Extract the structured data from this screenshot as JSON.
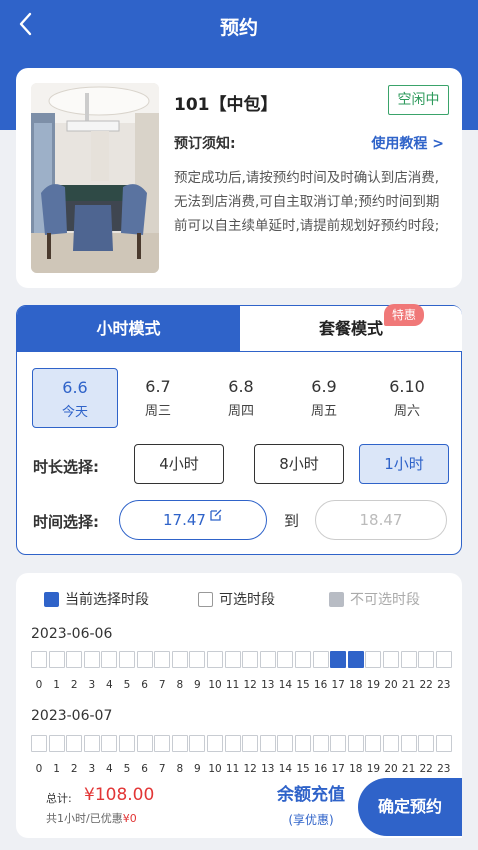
{
  "header": {
    "title": "预约"
  },
  "room": {
    "name": "101【中包】",
    "status": "空闲中",
    "notice_label": "预订须知:",
    "tutorial_link": "使用教程 >",
    "notice_text": "预定成功后,请按预约时间及时确认到店消费,无法到店消费,可自主取消订单;预约时间到期前可以自主续单延时,请提前规划好预约时段;"
  },
  "mode": {
    "tabs": [
      {
        "label": "小时模式",
        "active": true
      },
      {
        "label": "套餐模式",
        "active": false
      }
    ],
    "badge": "特惠",
    "dates": [
      {
        "date": "6.6",
        "weekday": "今天",
        "selected": true
      },
      {
        "date": "6.7",
        "weekday": "周三",
        "selected": false
      },
      {
        "date": "6.8",
        "weekday": "周四",
        "selected": false
      },
      {
        "date": "6.9",
        "weekday": "周五",
        "selected": false
      },
      {
        "date": "6.10",
        "weekday": "周六",
        "selected": false
      }
    ],
    "duration_label": "时长选择:",
    "durations": [
      {
        "label": "4小时",
        "selected": false
      },
      {
        "label": "8小时",
        "selected": false
      },
      {
        "label": "1小时",
        "selected": true
      }
    ],
    "time_label": "时间选择:",
    "start_time": "17.47",
    "to_label": "到",
    "end_time": "18.47"
  },
  "slots": {
    "legend": {
      "current": "当前选择时段",
      "available": "可选时段",
      "unavailable": "不可选时段"
    },
    "days": [
      {
        "date": "2023-06-06",
        "selected_slots": [
          17,
          18
        ]
      },
      {
        "date": "2023-06-07",
        "selected_slots": []
      }
    ],
    "hours": [
      "0",
      "1",
      "2",
      "3",
      "4",
      "5",
      "6",
      "7",
      "8",
      "9",
      "10",
      "11",
      "12",
      "13",
      "14",
      "15",
      "16",
      "17",
      "18",
      "19",
      "20",
      "21",
      "22",
      "23"
    ]
  },
  "footer": {
    "total_label": "总计:",
    "total_value": "¥108.00",
    "sub_prefix": "共1小时/已优惠",
    "sub_discount": "¥0",
    "recharge_title": "余额充值",
    "recharge_sub": "(享优惠)",
    "confirm_label": "确定预约"
  },
  "colors": {
    "primary": "#2f63c9",
    "price": "#e23636",
    "idle": "#2e9a5c",
    "badge": "#f07878"
  }
}
